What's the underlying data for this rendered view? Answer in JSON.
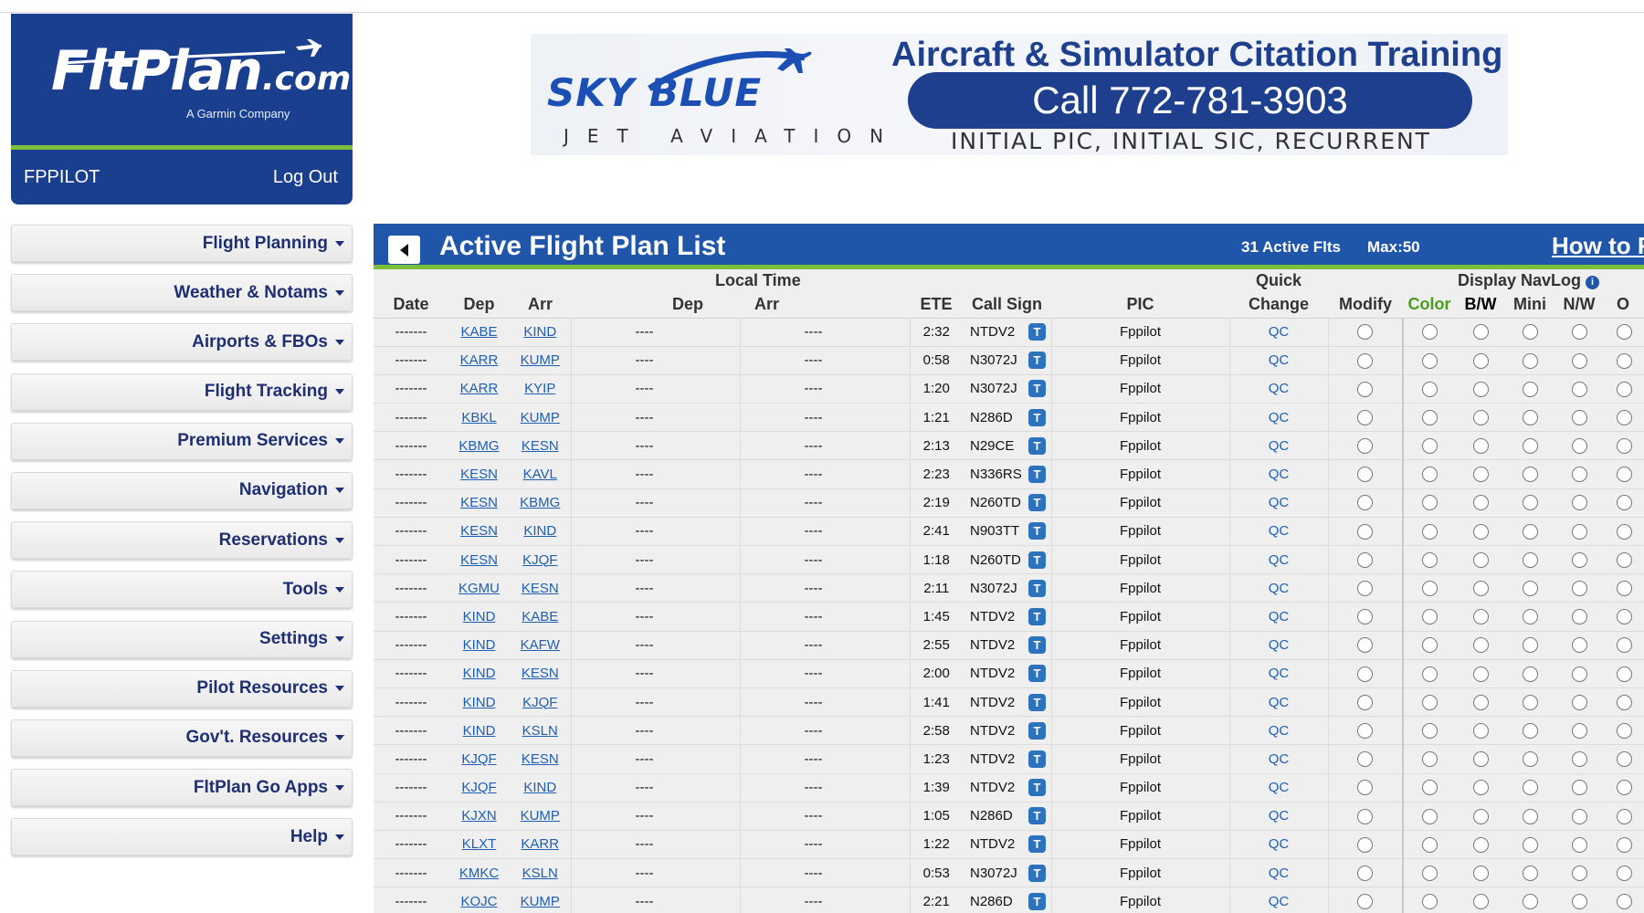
{
  "logo": {
    "name": "FltPlan",
    "suffix": ".com",
    "tagline": "A Garmin Company"
  },
  "user": {
    "name": "FPPILOT",
    "logout_label": "Log Out"
  },
  "menu": [
    "Flight Planning",
    "Weather & Notams",
    "Airports & FBOs",
    "Flight Tracking",
    "Premium Services",
    "Navigation",
    "Reservations",
    "Tools",
    "Settings",
    "Pilot Resources",
    "Gov't. Resources",
    "FltPlan Go Apps",
    "Help"
  ],
  "banner": {
    "logo_text": "SKY BLUE",
    "logo_sub": "JET AVIATION",
    "title": "Aircraft & Simulator Citation Training",
    "phone": "Call 772-781-3903",
    "subtitle": "INITIAL PIC, INITIAL SIC, RECURRENT"
  },
  "panel": {
    "title": "Active Flight Plan List",
    "active_count": "31 Active Flts",
    "max": "Max:50",
    "howto": "How to F"
  },
  "columns": {
    "date": "Date",
    "dep": "Dep",
    "arr": "Arr",
    "local_time": "Local Time",
    "lt_dep": "Dep",
    "lt_arr": "Arr",
    "ete": "ETE",
    "call_sign": "Call Sign",
    "pic": "PIC",
    "quick": "Quick",
    "change": "Change",
    "modify": "Modify",
    "display_navlog": "Display NavLog",
    "color": "Color",
    "bw": "B/W",
    "mini": "Mini",
    "nw": "N/W",
    "o": "O"
  },
  "rows": [
    {
      "date": "-------",
      "dep": "KABE",
      "arr": "KIND",
      "lt_dep": "----",
      "lt_arr": "----",
      "ete": "2:32",
      "call": "NTDV2",
      "pic": "Fppilot",
      "qc": "QC"
    },
    {
      "date": "-------",
      "dep": "KARR",
      "arr": "KUMP",
      "lt_dep": "----",
      "lt_arr": "----",
      "ete": "0:58",
      "call": "N3072J",
      "pic": "Fppilot",
      "qc": "QC"
    },
    {
      "date": "-------",
      "dep": "KARR",
      "arr": "KYIP",
      "lt_dep": "----",
      "lt_arr": "----",
      "ete": "1:20",
      "call": "N3072J",
      "pic": "Fppilot",
      "qc": "QC"
    },
    {
      "date": "-------",
      "dep": "KBKL",
      "arr": "KUMP",
      "lt_dep": "----",
      "lt_arr": "----",
      "ete": "1:21",
      "call": "N286D",
      "pic": "Fppilot",
      "qc": "QC"
    },
    {
      "date": "-------",
      "dep": "KBMG",
      "arr": "KESN",
      "lt_dep": "----",
      "lt_arr": "----",
      "ete": "2:13",
      "call": "N29CE",
      "pic": "Fppilot",
      "qc": "QC"
    },
    {
      "date": "-------",
      "dep": "KESN",
      "arr": "KAVL",
      "lt_dep": "----",
      "lt_arr": "----",
      "ete": "2:23",
      "call": "N336RS",
      "pic": "Fppilot",
      "qc": "QC"
    },
    {
      "date": "-------",
      "dep": "KESN",
      "arr": "KBMG",
      "lt_dep": "----",
      "lt_arr": "----",
      "ete": "2:19",
      "call": "N260TD",
      "pic": "Fppilot",
      "qc": "QC"
    },
    {
      "date": "-------",
      "dep": "KESN",
      "arr": "KIND",
      "lt_dep": "----",
      "lt_arr": "----",
      "ete": "2:41",
      "call": "N903TT",
      "pic": "Fppilot",
      "qc": "QC"
    },
    {
      "date": "-------",
      "dep": "KESN",
      "arr": "KJQF",
      "lt_dep": "----",
      "lt_arr": "----",
      "ete": "1:18",
      "call": "N260TD",
      "pic": "Fppilot",
      "qc": "QC"
    },
    {
      "date": "-------",
      "dep": "KGMU",
      "arr": "KESN",
      "lt_dep": "----",
      "lt_arr": "----",
      "ete": "2:11",
      "call": "N3072J",
      "pic": "Fppilot",
      "qc": "QC"
    },
    {
      "date": "-------",
      "dep": "KIND",
      "arr": "KABE",
      "lt_dep": "----",
      "lt_arr": "----",
      "ete": "1:45",
      "call": "NTDV2",
      "pic": "Fppilot",
      "qc": "QC"
    },
    {
      "date": "-------",
      "dep": "KIND",
      "arr": "KAFW",
      "lt_dep": "----",
      "lt_arr": "----",
      "ete": "2:55",
      "call": "NTDV2",
      "pic": "Fppilot",
      "qc": "QC"
    },
    {
      "date": "-------",
      "dep": "KIND",
      "arr": "KESN",
      "lt_dep": "----",
      "lt_arr": "----",
      "ete": "2:00",
      "call": "NTDV2",
      "pic": "Fppilot",
      "qc": "QC"
    },
    {
      "date": "-------",
      "dep": "KIND",
      "arr": "KJQF",
      "lt_dep": "----",
      "lt_arr": "----",
      "ete": "1:41",
      "call": "NTDV2",
      "pic": "Fppilot",
      "qc": "QC"
    },
    {
      "date": "-------",
      "dep": "KIND",
      "arr": "KSLN",
      "lt_dep": "----",
      "lt_arr": "----",
      "ete": "2:58",
      "call": "NTDV2",
      "pic": "Fppilot",
      "qc": "QC"
    },
    {
      "date": "-------",
      "dep": "KJQF",
      "arr": "KESN",
      "lt_dep": "----",
      "lt_arr": "----",
      "ete": "1:23",
      "call": "NTDV2",
      "pic": "Fppilot",
      "qc": "QC"
    },
    {
      "date": "-------",
      "dep": "KJQF",
      "arr": "KIND",
      "lt_dep": "----",
      "lt_arr": "----",
      "ete": "1:39",
      "call": "NTDV2",
      "pic": "Fppilot",
      "qc": "QC"
    },
    {
      "date": "-------",
      "dep": "KJXN",
      "arr": "KUMP",
      "lt_dep": "----",
      "lt_arr": "----",
      "ete": "1:05",
      "call": "N286D",
      "pic": "Fppilot",
      "qc": "QC"
    },
    {
      "date": "-------",
      "dep": "KLXT",
      "arr": "KARR",
      "lt_dep": "----",
      "lt_arr": "----",
      "ete": "1:22",
      "call": "NTDV2",
      "pic": "Fppilot",
      "qc": "QC"
    },
    {
      "date": "-------",
      "dep": "KMKC",
      "arr": "KSLN",
      "lt_dep": "----",
      "lt_arr": "----",
      "ete": "0:53",
      "call": "N3072J",
      "pic": "Fppilot",
      "qc": "QC"
    },
    {
      "date": "-------",
      "dep": "KOJC",
      "arr": "KUMP",
      "lt_dep": "----",
      "lt_arr": "----",
      "ete": "2:21",
      "call": "N286D",
      "pic": "Fppilot",
      "qc": "QC"
    }
  ],
  "colors": {
    "brand_blue": "#1b3f8f",
    "header_blue": "#1f56aa",
    "accent_green": "#7bbf3a",
    "link": "#1f5fb3"
  }
}
